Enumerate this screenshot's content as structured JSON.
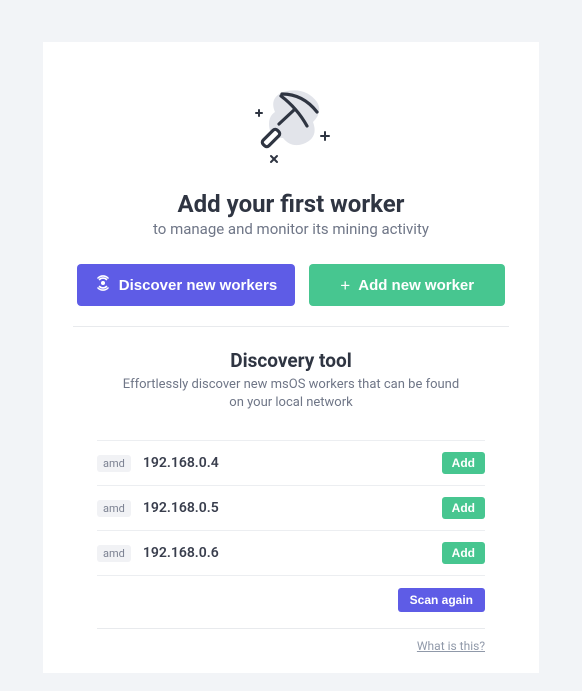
{
  "header": {
    "title": "Add your first worker",
    "subtitle": "to manage and monitor its mining activity"
  },
  "actions": {
    "discover_label": "Discover new workers",
    "add_label": "Add new worker"
  },
  "discovery": {
    "title": "Discovery tool",
    "subtitle": "Effortlessly discover new msOS workers that can be found on your local network",
    "add_button": "Add",
    "scan_button": "Scan again",
    "footer_link": "What is this?",
    "workers": [
      {
        "vendor": "amd",
        "ip": "192.168.0.4"
      },
      {
        "vendor": "amd",
        "ip": "192.168.0.5"
      },
      {
        "vendor": "amd",
        "ip": "192.168.0.6"
      }
    ]
  }
}
